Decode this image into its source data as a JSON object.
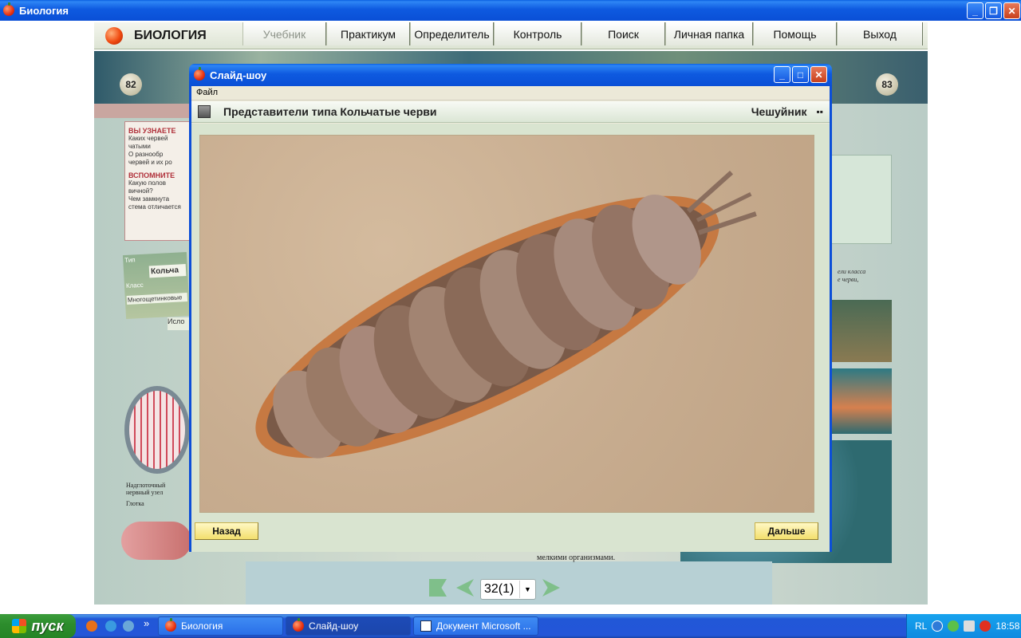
{
  "window": {
    "title": "Биология"
  },
  "app": {
    "logo_text": "БИОЛОГИЯ",
    "menu": [
      {
        "label": "Учебник",
        "disabled": true
      },
      {
        "label": "Практикум"
      },
      {
        "label": "Определитель"
      },
      {
        "label": "Контроль"
      },
      {
        "label": "Поиск"
      },
      {
        "label": "Личная папка"
      },
      {
        "label": "Помощь"
      },
      {
        "label": "Выход"
      }
    ]
  },
  "book": {
    "left_page": "82",
    "right_page": "83",
    "left_snippets": [
      "ВЫ УЗНАЕТЕ",
      "Каких червей",
      "чатыми",
      "О разнообр",
      "червей и их ро",
      "ВСПОМНИТЕ",
      "Какую полов",
      "вичной?",
      "Чем замкнута",
      "стема отличается"
    ],
    "label_card": [
      "Тип",
      "Кольча",
      "Класс",
      "Многощетинковые",
      "Исло"
    ],
    "diagram_labels": [
      "Надглоточный",
      "нервный узел",
      "Глотка"
    ],
    "right_snippets": [
      "ели класса",
      "е черви,"
    ],
    "bottom_text": "мелкими организмами.",
    "page_counter": "32(1)"
  },
  "slideshow": {
    "title": "Слайд-шоу",
    "menu_file": "Файл",
    "heading": "Представители типа Кольчатые черви",
    "species": "Чешуйник",
    "back": "Назад",
    "next": "Дальше"
  },
  "taskbar": {
    "start": "пуск",
    "overflow": "»",
    "tasks": [
      {
        "label": "Биология"
      },
      {
        "label": "Слайд-шоу",
        "active": true
      },
      {
        "label": "Документ Microsoft ..."
      }
    ],
    "lang": "RL",
    "clock": "18:58"
  }
}
